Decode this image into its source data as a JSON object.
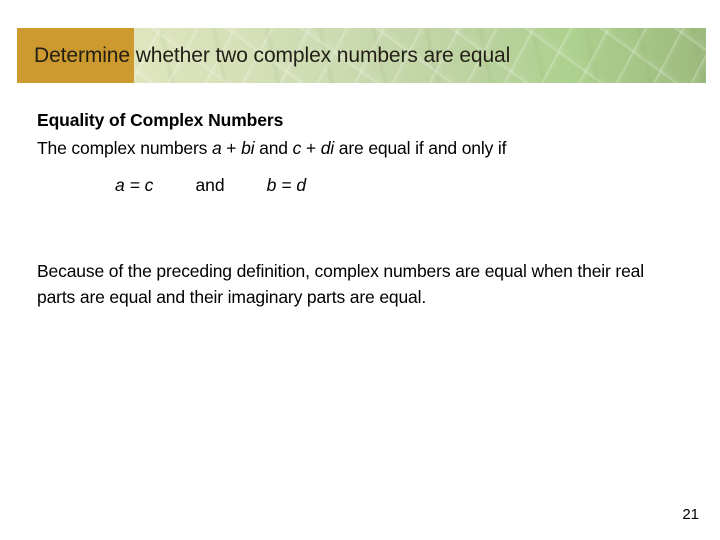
{
  "slide": {
    "title": "Determine whether two complex numbers are equal",
    "accent_color": "#cc9a2e",
    "banner_green_left": "#e9ecca",
    "banner_green_right": "#9cba7d",
    "background_color": "#ffffff",
    "text_color": "#000000"
  },
  "definition": {
    "heading": "Equality of Complex Numbers",
    "statement_prefix": "The complex numbers ",
    "var_a": "a",
    "plus_1": " + ",
    "var_bi": "bi",
    "middle": " and ",
    "var_c": "c",
    "plus_2": " + ",
    "var_di": "di",
    "statement_suffix": " are equal if and only if",
    "equation_left": "a = c",
    "equation_conjunction": "and",
    "equation_right": "b = d"
  },
  "explanation": {
    "text": "Because of the preceding definition, complex numbers are equal when their real parts are equal and their imaginary parts are equal."
  },
  "footer": {
    "page_number": "21"
  }
}
